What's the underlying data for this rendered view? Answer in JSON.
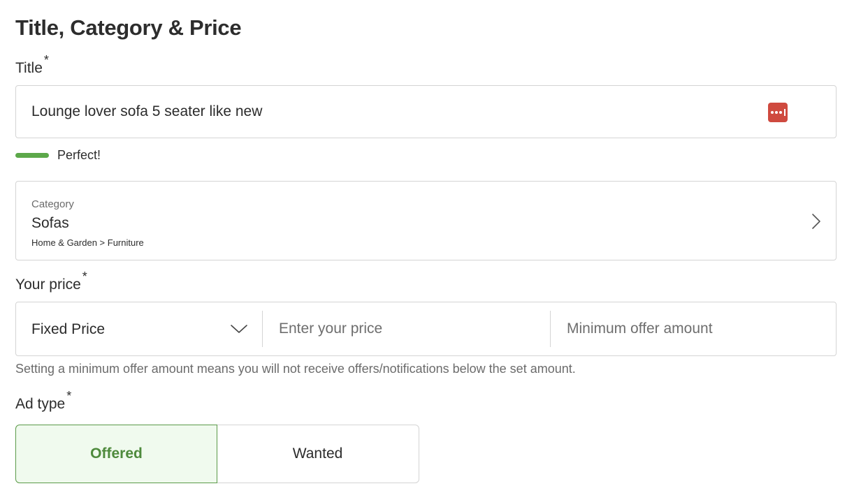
{
  "section": {
    "heading": "Title, Category & Price"
  },
  "title_field": {
    "label": "Title",
    "required_mark": "*",
    "value": "Lounge lover sofa 5 seater like new",
    "password_manager_icon": "password-manager-icon",
    "strength_text": "Perfect!",
    "strength_color": "#5ca84a"
  },
  "category": {
    "label": "Category",
    "value": "Sofas",
    "path": "Home & Garden > Furniture",
    "icon": "chevron-right-icon"
  },
  "price": {
    "label": "Your price",
    "required_mark": "*",
    "type_selected": "Fixed Price",
    "type_icon": "chevron-down-icon",
    "price_placeholder": "Enter your price",
    "min_offer_placeholder": "Minimum offer amount",
    "helper_text": "Setting a minimum offer amount means you will not receive offers/notifications below the set amount."
  },
  "ad_type": {
    "label": "Ad type",
    "required_mark": "*",
    "options": [
      {
        "label": "Offered",
        "selected": true
      },
      {
        "label": "Wanted",
        "selected": false
      }
    ],
    "selected_color": "#4e8a3c"
  }
}
